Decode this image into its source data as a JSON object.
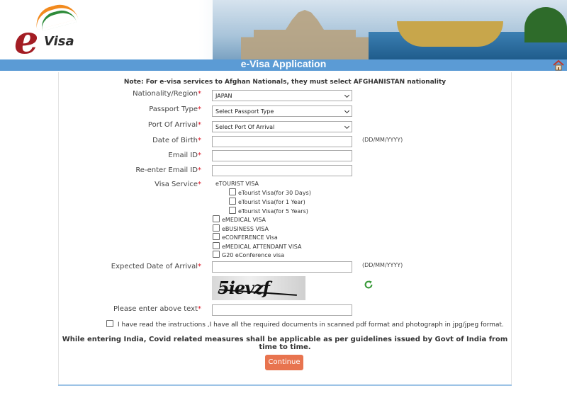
{
  "header": {
    "logo_text": "Visa",
    "title": "e-Visa Application"
  },
  "note": "Note: For e-visa services to Afghan Nationals, they must select AFGHANISTAN nationality",
  "form": {
    "nationality": {
      "label": "Nationality/Region",
      "value": "JAPAN"
    },
    "passport_type": {
      "label": "Passport Type",
      "value": "Select Passport Type"
    },
    "port_of_arrival": {
      "label": "Port Of Arrival",
      "value": "Select Port Of Arrival"
    },
    "dob": {
      "label": "Date of Birth",
      "hint": "(DD/MM/YYYY)",
      "value": ""
    },
    "email": {
      "label": "Email ID",
      "value": ""
    },
    "email_confirm": {
      "label": "Re-enter Email ID",
      "value": ""
    },
    "visa_service": {
      "label": "Visa Service",
      "group_heading": "eTOURIST VISA",
      "tourist_options": [
        "eTourist Visa(for 30 Days)",
        "eTourist Visa(for 1 Year)",
        "eTourist Visa(for 5 Years)"
      ],
      "other_options": [
        "eMEDICAL VISA",
        "eBUSINESS VISA",
        "eCONFERENCE Visa",
        "eMEDICAL ATTENDANT VISA",
        "G20 eConference visa"
      ]
    },
    "expected_arrival": {
      "label": "Expected Date of Arrival",
      "hint": "(DD/MM/YYYY)",
      "value": ""
    },
    "captcha_text": "5ievzf",
    "captcha_input": {
      "label": "Please enter above text",
      "value": ""
    },
    "required_mark": "*"
  },
  "consent_text": "I have read the instructions ,I have all the required documents in scanned pdf format and photograph in jpg/jpeg format.",
  "covid_note": "While entering India, Covid related measures shall be applicable as per guidelines issued by Govt of India from time to time.",
  "continue_label": "Continue"
}
